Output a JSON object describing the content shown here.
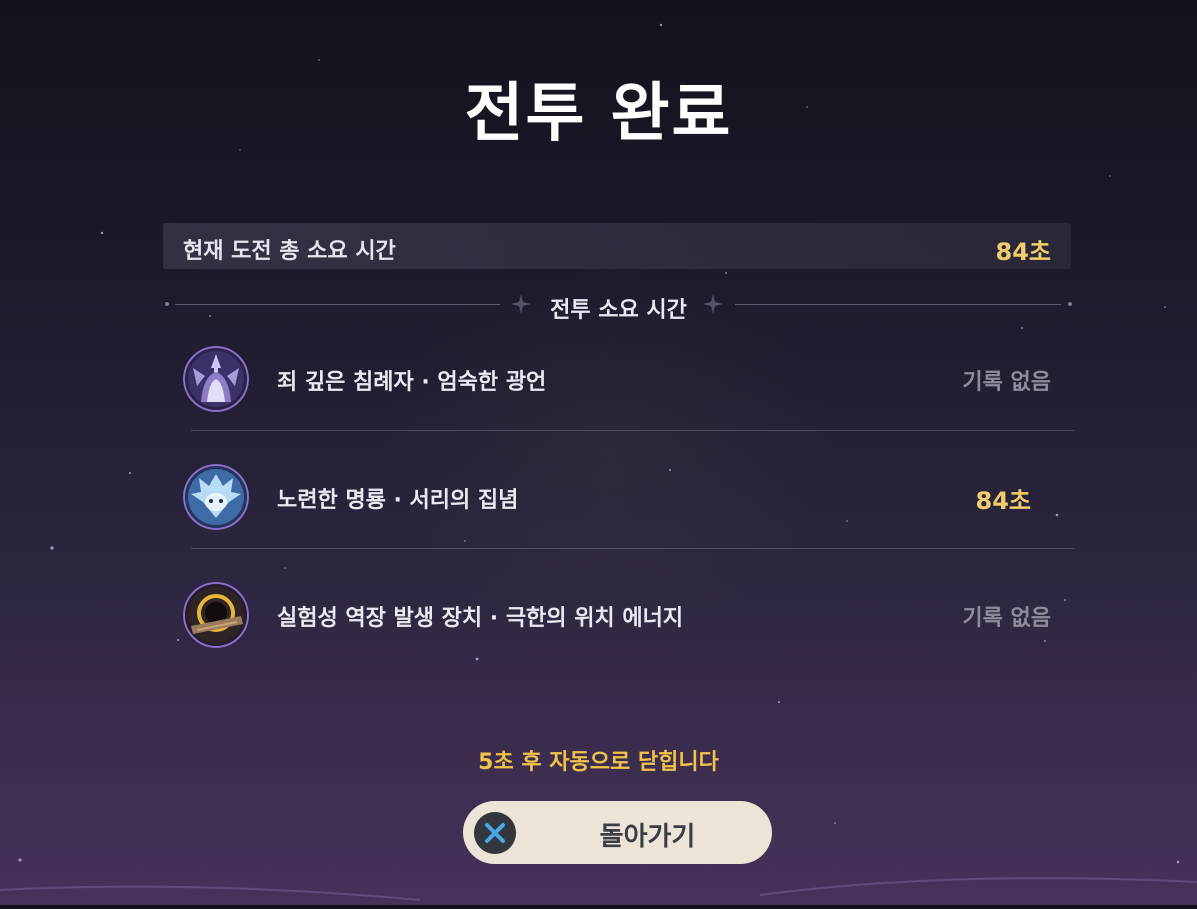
{
  "screen": {
    "title": "전투 완료"
  },
  "summary": {
    "label": "현재 도전 총 소요 시간",
    "value": "84초"
  },
  "section": {
    "label": "전투 소요 시간"
  },
  "bosses": [
    {
      "name": "죄 깊은 침례자 · 엄숙한 광언",
      "time": "기록 없음",
      "icon": "sinful-baptist-boss-icon"
    },
    {
      "name": "노련한 명룡 · 서리의 집념",
      "time": "84초",
      "icon": "frost-dragon-boss-icon"
    },
    {
      "name": "실험성 역장 발생 장치 · 극한의 위치 에너지",
      "time": "기록 없음",
      "icon": "field-generator-boss-icon"
    }
  ],
  "footer": {
    "auto_close": "5초 후 자동으로 닫힙니다",
    "back_label": "돌아가기",
    "back_icon": "close-x-icon"
  },
  "colors": {
    "accent_gold": "#f2cd6b",
    "auto_close_yellow": "#f0c24a",
    "button_bg": "#ece4d6",
    "icon_ring": "#8c6fd0",
    "close_icon_x": "#4aa8e8"
  }
}
